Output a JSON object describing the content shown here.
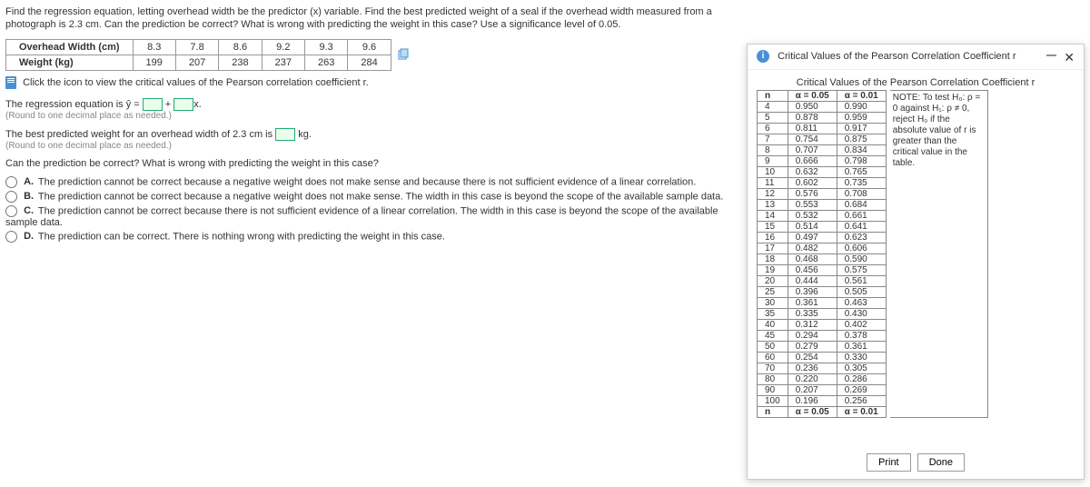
{
  "question": "Find the regression equation, letting overhead width be the predictor (x) variable. Find the best predicted weight of a seal if the overhead width measured from a photograph is 2.3 cm. Can the prediction be correct? What is wrong with predicting the weight in this case? Use a significance level of 0.05.",
  "data_table": {
    "row1_label": "Overhead Width (cm)",
    "row2_label": "Weight (kg)",
    "widths": [
      "8.3",
      "7.8",
      "8.6",
      "9.2",
      "9.3",
      "9.6"
    ],
    "weights": [
      "199",
      "207",
      "238",
      "237",
      "263",
      "284"
    ]
  },
  "link_text": "Click the icon to view the critical values of the Pearson correlation coefficient r.",
  "eq_prefix": "The regression equation is ŷ = ",
  "eq_mid": " + ",
  "eq_suffix": "x.",
  "round_hint": "(Round to one decimal place as needed.)",
  "best_pred_prefix": "The best predicted weight for an overhead width of 2.3 cm is ",
  "best_pred_suffix": " kg.",
  "mc_question": "Can the prediction be correct? What is wrong with predicting the weight in this case?",
  "options": {
    "A": "The prediction cannot be correct because a negative weight does not make sense and because there is not sufficient evidence of a linear correlation.",
    "B": "The prediction cannot be correct because a negative weight does not make sense. The width in this case is beyond the scope of the available sample data.",
    "C": "The prediction cannot be correct because there is not sufficient evidence of a linear correlation. The width in this case is beyond the scope of the available sample data.",
    "D": "The prediction can be correct. There is nothing wrong with predicting the weight in this case."
  },
  "dialog": {
    "title": "Critical Values of the Pearson Correlation Coefficient r",
    "table_title": "Critical Values of the Pearson Correlation Coefficient r",
    "col_n": "n",
    "col_a05": "α = 0.05",
    "col_a01": "α = 0.01",
    "note": "NOTE: To test H₀: ρ = 0 against H₁: ρ ≠ 0, reject H₀ if the absolute value of r is greater than the critical value in the table.",
    "rows": [
      [
        "4",
        "0.950",
        "0.990"
      ],
      [
        "5",
        "0.878",
        "0.959"
      ],
      [
        "6",
        "0.811",
        "0.917"
      ],
      [
        "7",
        "0.754",
        "0.875"
      ],
      [
        "8",
        "0.707",
        "0.834"
      ],
      [
        "9",
        "0.666",
        "0.798"
      ],
      [
        "10",
        "0.632",
        "0.765"
      ],
      [
        "11",
        "0.602",
        "0.735"
      ],
      [
        "12",
        "0.576",
        "0.708"
      ],
      [
        "13",
        "0.553",
        "0.684"
      ],
      [
        "14",
        "0.532",
        "0.661"
      ],
      [
        "15",
        "0.514",
        "0.641"
      ],
      [
        "16",
        "0.497",
        "0.623"
      ],
      [
        "17",
        "0.482",
        "0.606"
      ],
      [
        "18",
        "0.468",
        "0.590"
      ],
      [
        "19",
        "0.456",
        "0.575"
      ],
      [
        "20",
        "0.444",
        "0.561"
      ],
      [
        "25",
        "0.396",
        "0.505"
      ],
      [
        "30",
        "0.361",
        "0.463"
      ],
      [
        "35",
        "0.335",
        "0.430"
      ],
      [
        "40",
        "0.312",
        "0.402"
      ],
      [
        "45",
        "0.294",
        "0.378"
      ],
      [
        "50",
        "0.279",
        "0.361"
      ],
      [
        "60",
        "0.254",
        "0.330"
      ],
      [
        "70",
        "0.236",
        "0.305"
      ],
      [
        "80",
        "0.220",
        "0.286"
      ],
      [
        "90",
        "0.207",
        "0.269"
      ],
      [
        "100",
        "0.196",
        "0.256"
      ]
    ],
    "print": "Print",
    "done": "Done"
  }
}
